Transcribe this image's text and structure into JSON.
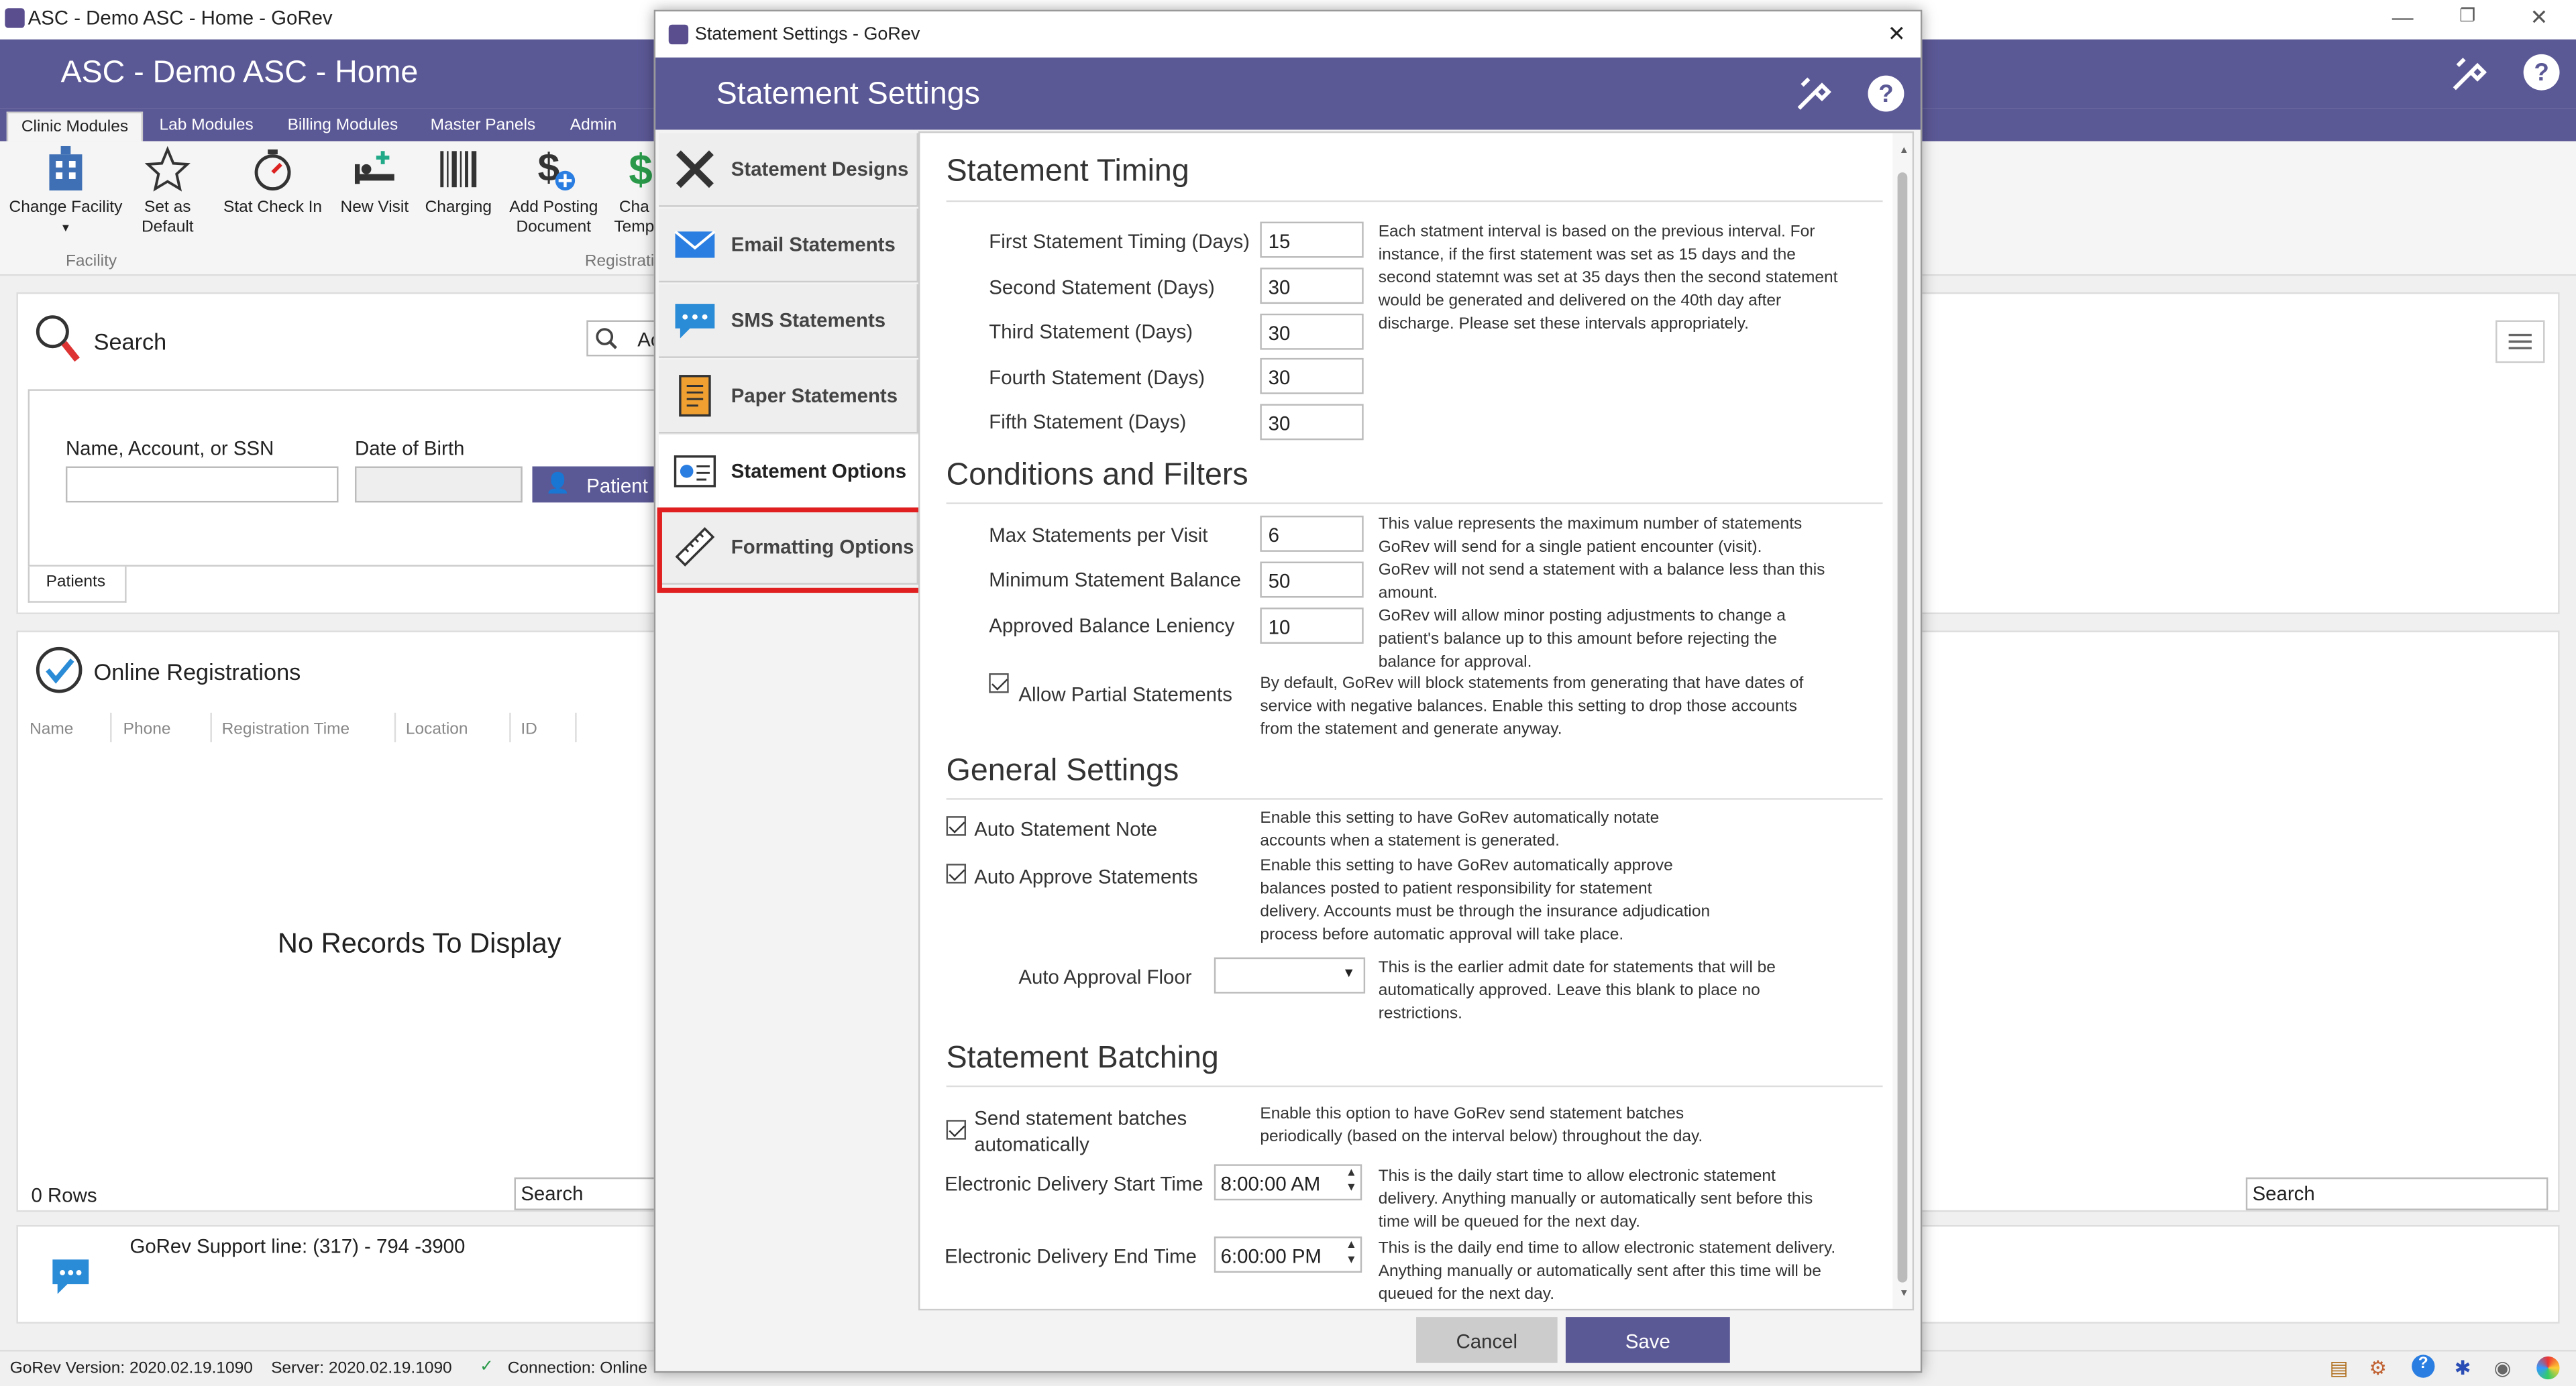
{
  "window": {
    "title": "ASC - Demo ASC - Home - GoRev"
  },
  "header": {
    "title": "ASC - Demo ASC - Home"
  },
  "tabs": [
    "Clinic Modules",
    "Lab Modules",
    "Billing Modules",
    "Master Panels",
    "Admin"
  ],
  "ribbon": {
    "buttons": [
      "Change Facility",
      "Set as Default",
      "Stat Check In",
      "New Visit",
      "Charging",
      "Add Posting Document",
      "Cha Temp"
    ],
    "groups": [
      "Facility",
      "Registrati"
    ]
  },
  "search": {
    "title": "Search",
    "name_label": "Name, Account, or SSN",
    "dob_label": "Date of Birth",
    "patient_button": "Patient",
    "tab": "Patients",
    "partial_input": "Ac"
  },
  "online_reg": {
    "title": "Online Registrations",
    "columns": [
      "Name",
      "Phone",
      "Registration Time",
      "Location",
      "ID"
    ],
    "empty": "No Records To Display",
    "rows": "0 Rows",
    "search_placeholder": "Search"
  },
  "right_search": "Search",
  "support": {
    "text": "GoRev Support line: (317) - 794 -3900"
  },
  "status": {
    "version": "GoRev Version: 2020.02.19.1090",
    "server": "Server: 2020.02.19.1090",
    "connection": "Connection: Online"
  },
  "dialog": {
    "window_title": "Statement Settings - GoRev",
    "title": "Statement Settings",
    "sidebar": [
      "Statement Designs",
      "Email Statements",
      "SMS Statements",
      "Paper Statements",
      "Statement Options",
      "Formatting Options"
    ],
    "timing": {
      "title": "Statement Timing",
      "fields": [
        {
          "label": "First Statement Timing (Days)",
          "value": "15"
        },
        {
          "label": "Second Statement (Days)",
          "value": "30"
        },
        {
          "label": "Third Statement (Days)",
          "value": "30"
        },
        {
          "label": "Fourth Statement (Days)",
          "value": "30"
        },
        {
          "label": "Fifth Statement (Days)",
          "value": "30"
        }
      ],
      "desc": [
        "Each statment interval is based on the previous interval. For",
        "instance, if the first statement was set as 15 days and the",
        "second statemnt was set at 35 days then the second statement",
        "would be generated and delivered on the 40th day after",
        "discharge. Please set these intervals appropriately."
      ]
    },
    "conditions": {
      "title": "Conditions and Filters",
      "fields": [
        {
          "label": "Max Statements per Visit",
          "value": "6",
          "desc": [
            "This value represents the maximum number of statements",
            "GoRev will send for a single patient encounter (visit)."
          ]
        },
        {
          "label": "Minimum Statement Balance",
          "value": "50",
          "desc": [
            "GoRev will not send a statement with a balance less than this",
            "amount."
          ]
        },
        {
          "label": "Approved Balance Leniency",
          "value": "10",
          "desc": [
            "GoRev will allow minor posting adjustments to change a",
            "patient's balance up to this amount before rejecting the",
            "balance for approval."
          ]
        }
      ],
      "partial_label": "Allow Partial Statements",
      "partial_desc": [
        "By default, GoRev will block statements from generating that have dates of",
        "service with negative balances. Enable this setting to drop those accounts",
        "from the statement and generate anyway."
      ]
    },
    "general": {
      "title": "General Settings",
      "auto_note": "Auto Statement Note",
      "auto_note_desc": [
        "Enable this setting to have GoRev automatically notate",
        "accounts when a statement is generated."
      ],
      "auto_approve": "Auto Approve Statements",
      "auto_approve_desc": [
        "Enable this setting to have GoRev automatically approve",
        "balances posted to patient responsibility for statement",
        "delivery. Accounts must be through the insurance adjudication",
        "process before automatic approval will take place."
      ],
      "floor_label": "Auto Approval Floor",
      "floor_desc": [
        "This is the earlier admit date for statements that will be",
        "automatically approved. Leave this blank to place no",
        "restrictions."
      ]
    },
    "batching": {
      "title": "Statement Batching",
      "send_label": [
        "Send statement batches",
        "automatically"
      ],
      "send_desc": [
        "Enable this option to have GoRev send statement batches",
        "periodically (based on the interval below) throughout the day."
      ],
      "start_label": "Electronic Delivery Start Time",
      "start_value": "8:00:00 AM",
      "start_desc": [
        "This is the daily start time to allow electronic statement",
        "delivery. Anything manually or automatically sent before this",
        "time will be queued for the next day."
      ],
      "end_label": "Electronic Delivery End Time",
      "end_value": "6:00:00 PM",
      "end_desc": [
        "This is the daily end time to allow electronic statement delivery.",
        "Anything manually or automatically sent after this time will be",
        "queued for the next day."
      ]
    },
    "cancel": "Cancel",
    "save": "Save"
  },
  "colors": {
    "brand": "#5b5896",
    "highlight": "#e02020"
  }
}
